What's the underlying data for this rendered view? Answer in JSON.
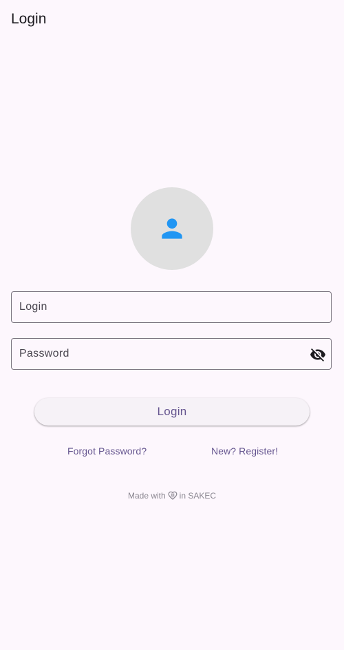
{
  "appbar": {
    "title": "Login"
  },
  "avatar": {
    "icon": "person-icon",
    "icon_color": "#2196f3",
    "background": "#e0e0e0"
  },
  "form": {
    "login_placeholder": "Login",
    "login_value": "",
    "password_placeholder": "Password",
    "password_value": "",
    "password_toggle_icon": "visibility-off-icon"
  },
  "actions": {
    "login_label": "Login",
    "forgot_password_label": "Forgot Password?",
    "register_label": "New? Register!"
  },
  "footer": {
    "made_with": "Made with",
    "heart_icon": "heart-icon",
    "location": "in SAKEC"
  },
  "colors": {
    "background": "#fdf7fd",
    "accent": "#65558f",
    "outline": "#79747e"
  }
}
